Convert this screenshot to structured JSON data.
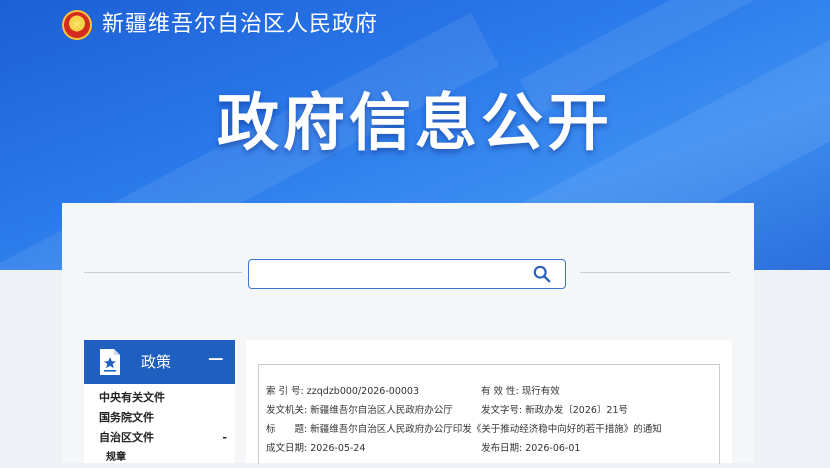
{
  "header": {
    "gov_name": "新疆维吾尔自治区人民政府",
    "hero_title": "政府信息公开",
    "emblem_glyph": "★"
  },
  "search": {
    "value": "",
    "placeholder": ""
  },
  "sidebar": {
    "title": "政策",
    "toggle": "−",
    "items": [
      {
        "label": "中央有关文件"
      },
      {
        "label": "国务院文件"
      },
      {
        "label": "自治区文件",
        "marker": "-"
      },
      {
        "label": "规章"
      }
    ]
  },
  "doc_meta": {
    "index_label": "索 引 号:",
    "index_value": "zzqdzb000/2026-00003",
    "validity_label": "有 效 性:",
    "validity_value": "现行有效",
    "issuer_label": "发文机关:",
    "issuer_value": "新疆维吾尔自治区人民政府办公厅",
    "docno_label": "发文字号:",
    "docno_value": "新政办发〔2026〕21号",
    "title_label": "标　　题:",
    "title_value": "新疆维吾尔自治区人民政府办公厅印发《关于推动经济稳中向好的若干措施》的通知",
    "created_label": "成文日期:",
    "created_value": "2026-05-24",
    "published_label": "发布日期:",
    "published_value": "2026-06-01"
  },
  "colors": {
    "banner": "#2a79ea",
    "sidebar_header": "#1f5fbf",
    "search_border": "#3d74d6"
  }
}
